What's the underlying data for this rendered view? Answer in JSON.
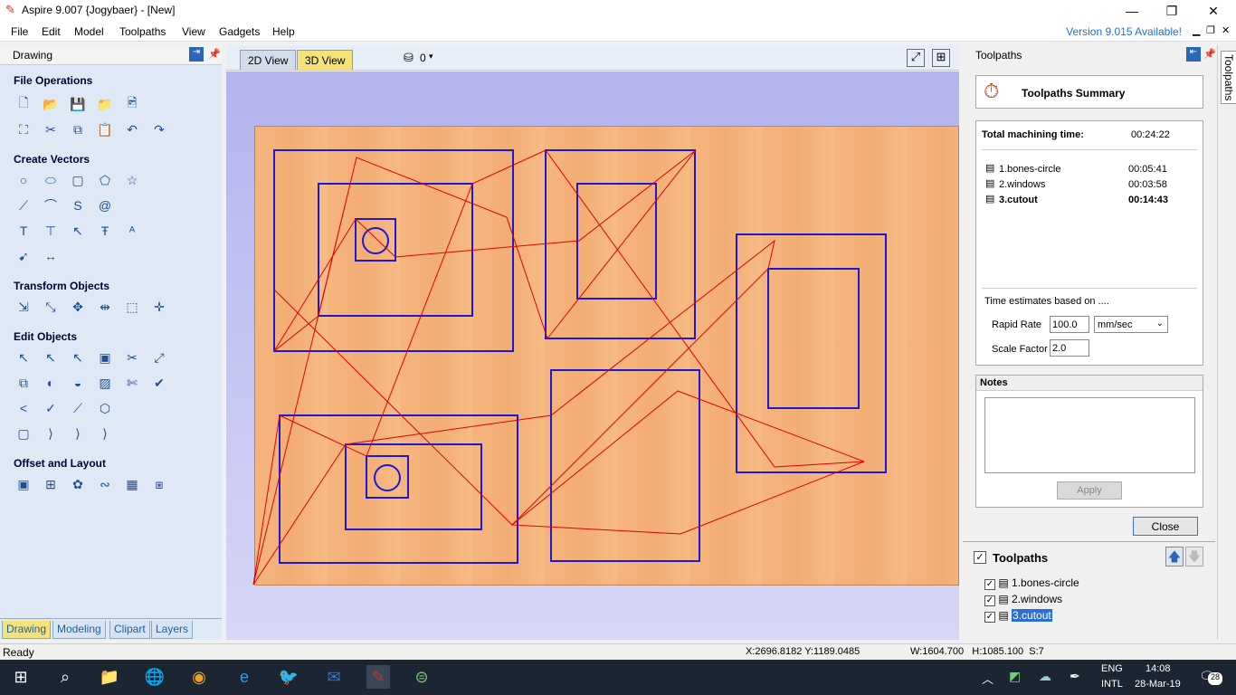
{
  "titlebar": {
    "title": "Aspire 9.007 {Jogybaer} - [New]"
  },
  "menubar": {
    "items": [
      "File",
      "Edit",
      "Model",
      "Toolpaths",
      "View",
      "Gadgets",
      "Help"
    ],
    "version_notice": "Version 9.015 Available!"
  },
  "left_panel": {
    "title": "Drawing",
    "sections": [
      "File Operations",
      "Create Vectors",
      "Transform Objects",
      "Edit Objects",
      "Offset and Layout"
    ],
    "tabs": [
      "Drawing",
      "Modeling",
      "Clipart",
      "Layers"
    ]
  },
  "view_tabs": {
    "tab_2d": "2D View",
    "tab_3d": "3D View",
    "layer_count": "0"
  },
  "right_panel": {
    "title": "Toolpaths",
    "side_tab": "Toolpaths",
    "summary_title": "Toolpaths Summary",
    "total_label": "Total machining time:",
    "total_value": "00:24:22",
    "rows": [
      {
        "name": "1.bones-circle",
        "time": "00:05:41"
      },
      {
        "name": "2.windows",
        "time": "00:03:58"
      },
      {
        "name": "3.cutout",
        "time": "00:14:43"
      }
    ],
    "estimates_label": "Time estimates based on ....",
    "rapid_label": "Rapid Rate",
    "rapid_value": "100.0",
    "rapid_unit": "mm/sec",
    "scale_label": "Scale Factor",
    "scale_value": "2.0",
    "notes_label": "Notes",
    "apply_label": "Apply",
    "close_label": "Close",
    "toolpaths_list_title": "Toolpaths",
    "list": [
      "1.bones-circle",
      "2.windows",
      "3.cutout"
    ]
  },
  "statusbar": {
    "status": "Ready",
    "coords": "X:2696.8182 Y:1189.0485",
    "dims": "W:1604.700   H:1085.100  S:7"
  },
  "taskbar": {
    "lang_top": "ENG",
    "lang_bottom": "INTL",
    "time": "14:08",
    "date": "28-Mar-19",
    "notifications": "28"
  }
}
